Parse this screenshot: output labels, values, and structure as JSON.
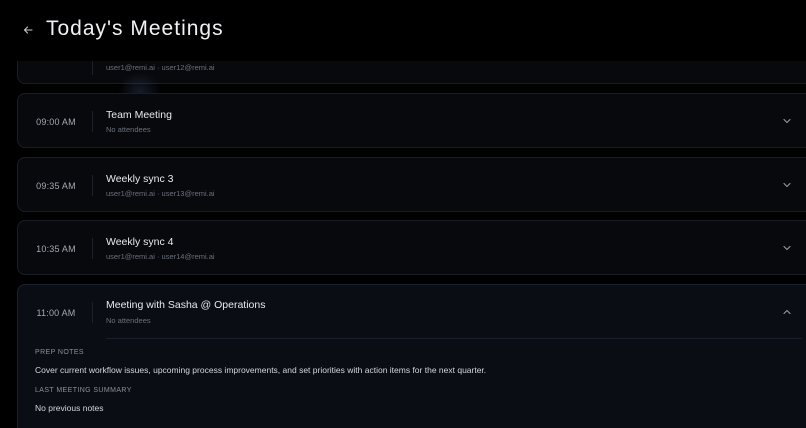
{
  "header": {
    "title": "Today's Meetings",
    "back_icon": "arrow-left-icon"
  },
  "meetings": [
    {
      "time": "",
      "title": "",
      "attendees": "user1@remi.ai · user12@remi.ai",
      "expanded": false
    },
    {
      "time": "09:00 AM",
      "title": "Team Meeting",
      "attendees": "No attendees",
      "expanded": false
    },
    {
      "time": "09:35 AM",
      "title": "Weekly sync 3",
      "attendees": "user1@remi.ai · user13@remi.ai",
      "expanded": false
    },
    {
      "time": "10:35 AM",
      "title": "Weekly sync 4",
      "attendees": "user1@remi.ai · user14@remi.ai",
      "expanded": false
    },
    {
      "time": "11:00 AM",
      "title": "Meeting with Sasha @ Operations",
      "attendees": "No attendees",
      "expanded": true,
      "prep_notes_label": "PREP NOTES",
      "prep_notes": "Cover current workflow issues, upcoming process improvements, and set priorities with action items for the next quarter.",
      "last_summary_label": "LAST MEETING SUMMARY",
      "last_summary": "No previous notes"
    }
  ],
  "icons": {
    "collapsed": "chevron-down-icon",
    "expanded": "chevron-up-icon"
  },
  "colors": {
    "background": "#000000",
    "card": "#08090d",
    "card_border": "#1a1d25",
    "text_primary": "#e8eaee",
    "text_muted": "#6b707b"
  }
}
